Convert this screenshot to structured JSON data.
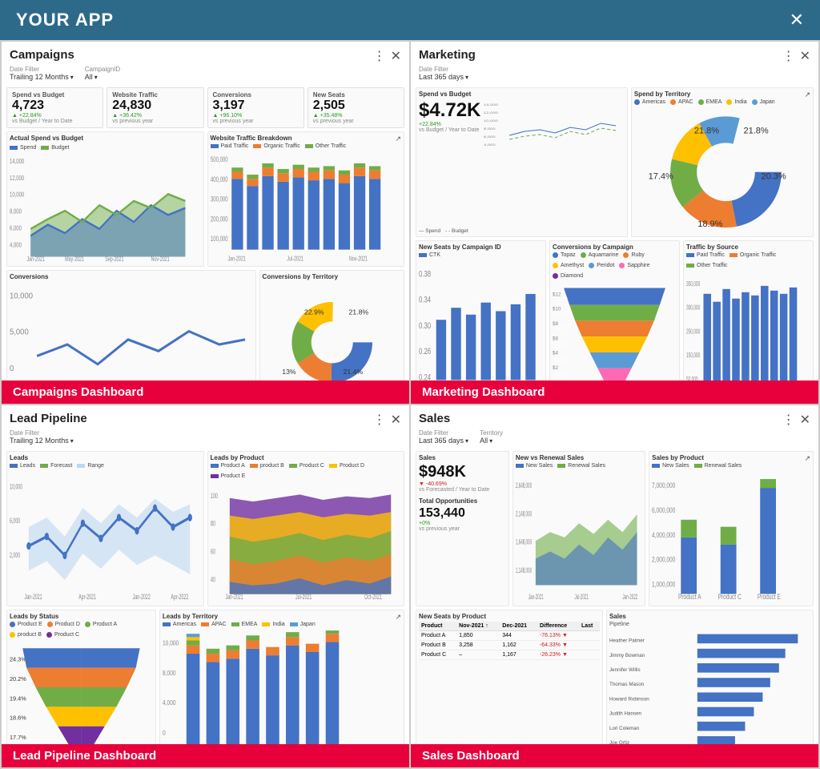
{
  "app": {
    "title": "YOUR APP",
    "close_label": "✕"
  },
  "panels": {
    "campaigns": {
      "title": "Campaigns",
      "filter_label": "Date Filter",
      "filter_value": "Trailing 12 Months",
      "filter2_label": "CampaignID",
      "filter2_value": "All",
      "badge": "Campaigns Dashboard",
      "metrics": [
        {
          "label": "Spend vs Budget",
          "value": "4,723",
          "change": "+22.84%",
          "change_dir": "positive",
          "sub": "vs Budget / Year to Date"
        },
        {
          "label": "Website Traffic",
          "value": "24,830",
          "change": "+36.42%",
          "change_dir": "positive",
          "sub": "vs previous year"
        },
        {
          "label": "Conversions",
          "value": "3,197",
          "change": "+96.10%",
          "change_dir": "positive",
          "sub": "vs previous year"
        },
        {
          "label": "New Seats",
          "value": "2,505",
          "change": "+35.48%",
          "change_dir": "positive",
          "sub": "vs previous year"
        }
      ]
    },
    "marketing": {
      "title": "Marketing",
      "filter_label": "Date Filter",
      "filter_value": "Last 365 days",
      "badge": "Marketing Dashboard",
      "spend_label": "Spend vs Budget",
      "spend_value": "$4.72K",
      "spend_change": "+22.84%",
      "spend_change_dir": "positive",
      "spend_sub": "vs Budget / Year to Date"
    },
    "lead_pipeline": {
      "title": "Lead Pipeline",
      "filter_label": "Date Filter",
      "filter_value": "Trailing 12 Months",
      "badge": "Lead Pipeline Dashboard"
    },
    "sales": {
      "title": "Sales",
      "filter_label": "Date Filter",
      "filter_value": "Last 365 days",
      "filter2_label": "Territory",
      "filter2_value": "All",
      "badge": "Sales Dashboard",
      "sales_label": "Sales",
      "sales_value": "$948K",
      "sales_change": "-40.69%",
      "sales_change_dir": "negative",
      "sales_sub": "vs Forecasted / Year to Date",
      "opp_label": "Total Opportunities",
      "opp_value": "153,440",
      "opp_change": "+0%",
      "opp_sub": "vs previous year",
      "table_headers": [
        "Product",
        "Nov-2021",
        "Dec-2021",
        "Difference",
        "Last"
      ],
      "table_rows": [
        {
          "product": "Product A",
          "nov": "1,850",
          "dec": "344",
          "diff": "-76.13%",
          "diff_dir": "negative"
        },
        {
          "product": "Product B",
          "nov": "3,258",
          "dec": "1,162",
          "diff": "-64.33%",
          "diff_dir": "negative"
        },
        {
          "product": "Product C",
          "nov": "–",
          "dec": "1,167",
          "diff": "-26.23%",
          "diff_dir": "negative"
        }
      ]
    }
  },
  "colors": {
    "accent": "#2d6a8a",
    "badge": "#e8003c",
    "green": "#22a020",
    "red": "#cc2020",
    "blue": "#4472c4",
    "teal": "#70ad47",
    "orange": "#ed7d31",
    "purple": "#7030a0",
    "pink": "#ff69b4"
  }
}
